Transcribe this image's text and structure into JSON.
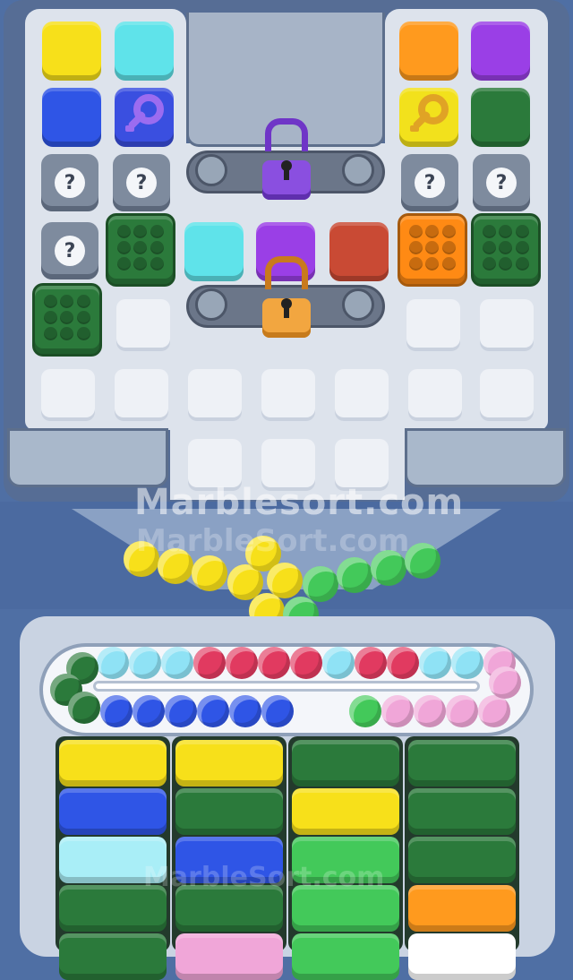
{
  "watermark": {
    "main": "Marblesort.com",
    "faint": "MarbleSort.com",
    "lower": "MarbleSort.com"
  },
  "colors": {
    "yellow": "#f7e01a",
    "cyan": "#5fe3ea",
    "orange": "#ff9a1e",
    "purple": "#9a3fe6",
    "blue": "#2f55e6",
    "green": "#2b7a3b",
    "red": "#c94a34",
    "lime": "#43c95a",
    "pink": "#f0a6d8",
    "crimson": "#e13a60",
    "sky": "#8fe2f5",
    "lock_purple": "#8a4fe0",
    "lock_orange": "#f2a640"
  },
  "tiles": [
    {
      "kind": "solid",
      "color": "#f7e01a",
      "name": "tile-yellow"
    },
    {
      "kind": "solid",
      "color": "#5fe3ea",
      "name": "tile-cyan"
    },
    {
      "kind": "solid",
      "color": "#2f55e6",
      "name": "tile-blue"
    },
    {
      "kind": "key",
      "color": "#3a4fe0",
      "key": "#9b6cf0",
      "name": "tile-blue-key"
    },
    {
      "kind": "solid",
      "color": "#ff9a1e",
      "name": "tile-orange"
    },
    {
      "kind": "solid",
      "color": "#9a3fe6",
      "name": "tile-purple"
    },
    {
      "kind": "key",
      "color": "#f2e11c",
      "key": "#e0a325",
      "name": "tile-yellow-key"
    },
    {
      "kind": "solid",
      "color": "#2b7a3b",
      "name": "tile-green"
    },
    {
      "kind": "mystery",
      "symbol": "?",
      "name": "mystery-tile"
    },
    {
      "kind": "bubble",
      "color": "#2b7a3b",
      "name": "bubble-tile-green"
    },
    {
      "kind": "bubble",
      "color": "#ff8a14",
      "name": "bubble-tile-orange"
    },
    {
      "kind": "solid",
      "color": "#5fe3ea",
      "name": "tile-cyan-2"
    },
    {
      "kind": "solid",
      "color": "#9a3fe6",
      "name": "tile-purple-2"
    },
    {
      "kind": "solid",
      "color": "#c94a34",
      "name": "tile-red"
    }
  ],
  "mystery_symbol": "?",
  "locks": [
    {
      "name": "purple-lock",
      "color": "#8a4fe0"
    },
    {
      "name": "orange-lock",
      "color": "#f2a640"
    }
  ],
  "funnel_marbles": [
    "#f7e01a",
    "#f7e01a",
    "#f7e01a",
    "#f7e01a",
    "#f7e01a",
    "#f7e01a",
    "#f7e01a",
    "#43c95a",
    "#43c95a",
    "#43c95a",
    "#43c95a",
    "#43c95a"
  ],
  "track_top": [
    "#8fe2f5",
    "#8fe2f5",
    "#8fe2f5",
    "#e13a60",
    "#e13a60",
    "#e13a60",
    "#e13a60",
    "#8fe2f5",
    "#e13a60",
    "#e13a60",
    "#8fe2f5",
    "#8fe2f5",
    "#f0a6d8"
  ],
  "track_bottom": [
    "#2f55e6",
    "#2f55e6",
    "#2f55e6",
    "#2f55e6",
    "#2f55e6",
    "#2f55e6",
    "#43c95a",
    "#f0a6d8",
    "#f0a6d8",
    "#f0a6d8",
    "#f0a6d8"
  ],
  "track_left": [
    "#2b7a3b",
    "#2b7a3b",
    "#2b7a3b"
  ],
  "columns": [
    [
      "#f7e01a",
      "#2f55e6",
      "#a9eef7",
      "#2b7a3b",
      "#2b7a3b"
    ],
    [
      "#f7e01a",
      "#2b7a3b",
      "#2f55e6",
      "#2b7a3b",
      "#f0a6d8"
    ],
    [
      "#2b7a3b",
      "#f7e01a",
      "#43c95a",
      "#43c95a",
      "#43c95a"
    ],
    [
      "#2b7a3b",
      "#2b7a3b",
      "#2b7a3b",
      "#ff9a1e",
      "#ffffff"
    ]
  ]
}
